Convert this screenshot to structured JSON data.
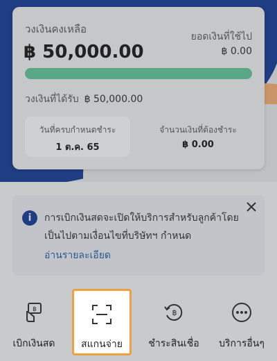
{
  "credit": {
    "label": "วงเงินคงเหลือ",
    "amount": "฿ 50,000.00",
    "used_label": "ยอดเงินที่ใช้ไป",
    "used_amount": "฿ 0.00",
    "remaining_fraction": 1.0,
    "received_label": "วงเงินที่ได้รับ",
    "received_amount": "฿ 50,000.00",
    "due_date_label": "วันที่ครบกำหนดชำระ",
    "due_date": "1 ต.ค. 65",
    "due_amount_label": "จำนวนเงินที่ต้องชำระ",
    "due_amount": "฿ 0.00"
  },
  "notice": {
    "text": "การเบิกเงินสดจะเปิดให้บริการสำหรับลูกค้าโดยเป็นไปตามเงื่อนไขที่บริษัทฯ กำหนด",
    "link": "อ่านรายละเอียด"
  },
  "actions": [
    {
      "label": "เบิกเงินสด",
      "icon": "cash-withdraw-icon"
    },
    {
      "label": "สแกนจ่าย",
      "icon": "scan-icon"
    },
    {
      "label": "ชำระสินเชื่อ",
      "icon": "loan-payment-icon"
    },
    {
      "label": "บริการอื่นๆ",
      "icon": "more-icon"
    }
  ],
  "colors": {
    "brand_blue": "#1f3d82",
    "progress_green": "#5aa786",
    "highlight_orange": "#f0a040"
  }
}
